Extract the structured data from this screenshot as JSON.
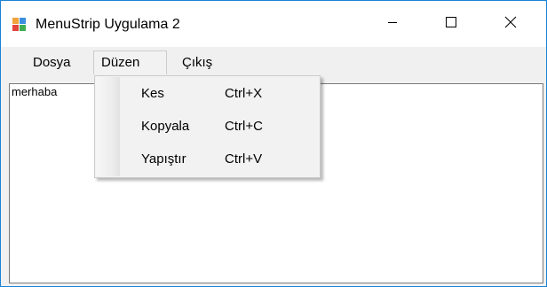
{
  "window": {
    "title": "MenuStrip Uygulama 2",
    "accent_border": "#1883d7",
    "app_icon": "windows-form-icon",
    "controls": {
      "minimize_icon": "minimize-icon",
      "maximize_icon": "maximize-icon",
      "close_icon": "close-icon"
    }
  },
  "menubar": {
    "items": [
      {
        "label": "Dosya"
      },
      {
        "label": "Düzen",
        "open": true
      },
      {
        "label": "Çıkış"
      }
    ]
  },
  "dropdown": {
    "items": [
      {
        "label": "Kes",
        "shortcut": "Ctrl+X"
      },
      {
        "label": "Kopyala",
        "shortcut": "Ctrl+C"
      },
      {
        "label": "Yapıştır",
        "shortcut": "Ctrl+V"
      }
    ]
  },
  "content": {
    "text": "merhaba"
  }
}
